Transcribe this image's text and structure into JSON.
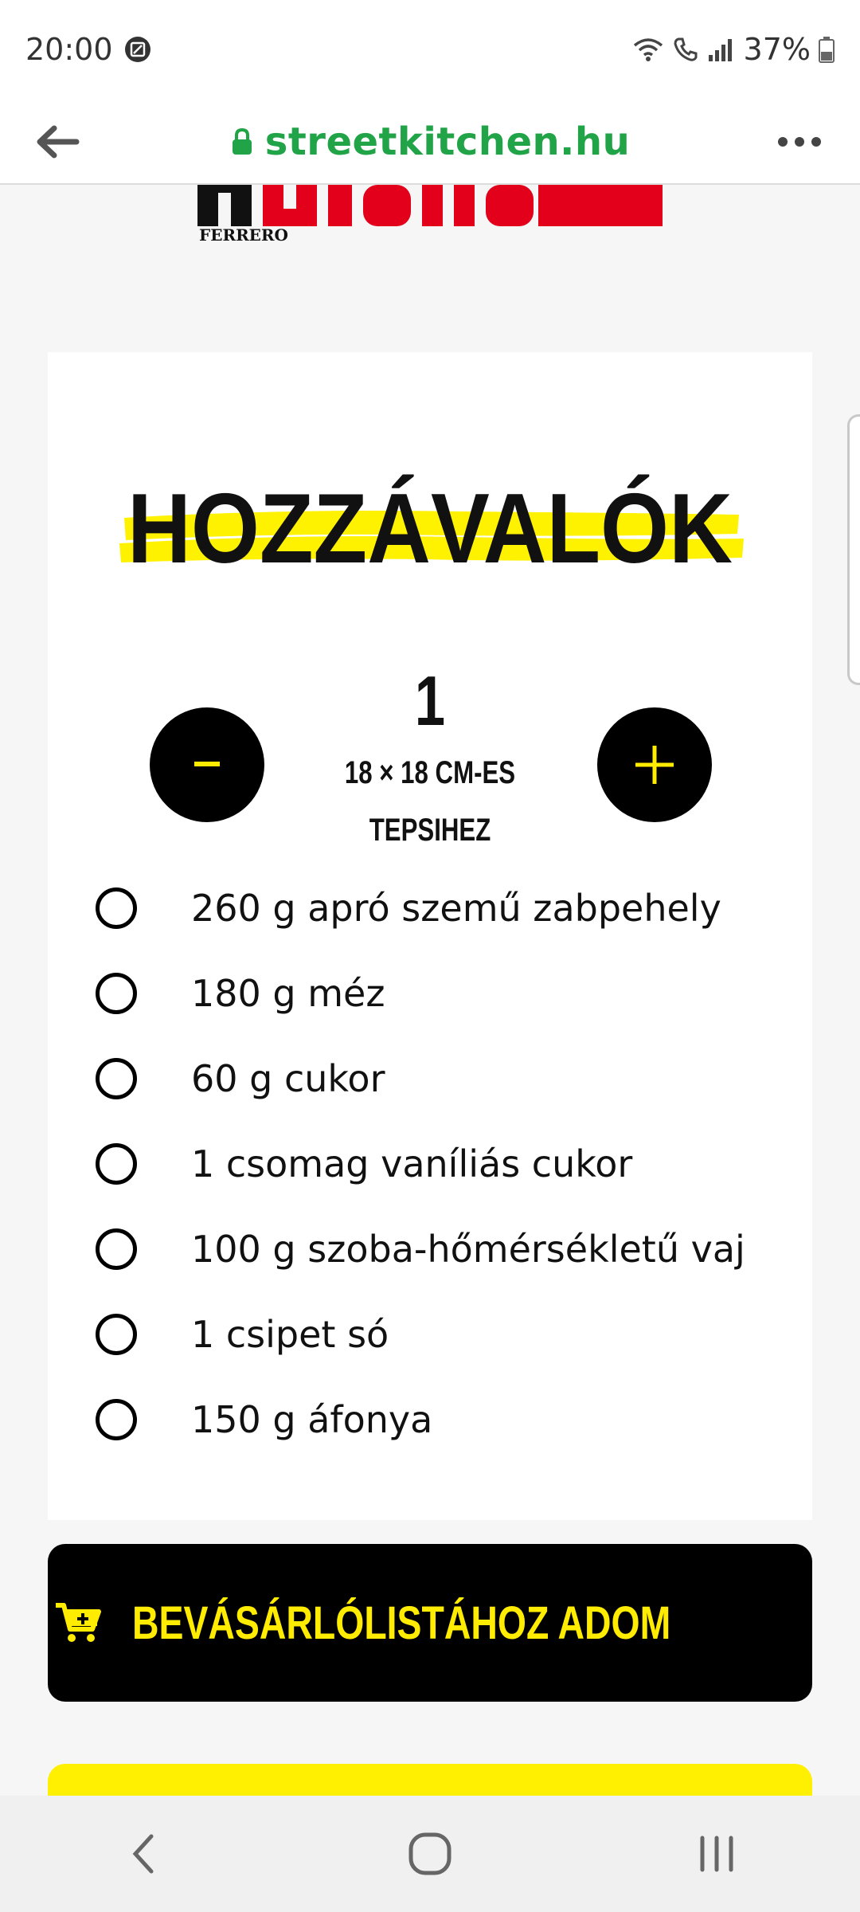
{
  "status_bar": {
    "time": "20:00",
    "battery": "37%"
  },
  "browser": {
    "url": "streetkitchen.hu"
  },
  "logo": {
    "brand": "nutella",
    "maker": "FERRERO"
  },
  "recipe": {
    "heading": "HOZZÁVALÓK",
    "servings": {
      "count": "1",
      "unit_line1": "18 × 18 CM-ES",
      "unit_line2": "TEPSIHEZ"
    },
    "ingredients": [
      "260 g apró szemű zabpehely",
      "180 g méz",
      "60 g cukor",
      "1 csomag vaníliás cukor",
      "100 g szoba-hőmérsékletű vaj",
      "1 csipet só",
      "150 g áfonya"
    ]
  },
  "cart_button": {
    "label": "BEVÁSÁRLÓLISTÁHOZ ADOM"
  },
  "colors": {
    "accent_yellow": "#ffec00",
    "url_green": "#21a347",
    "nutella_red": "#e2001a"
  }
}
